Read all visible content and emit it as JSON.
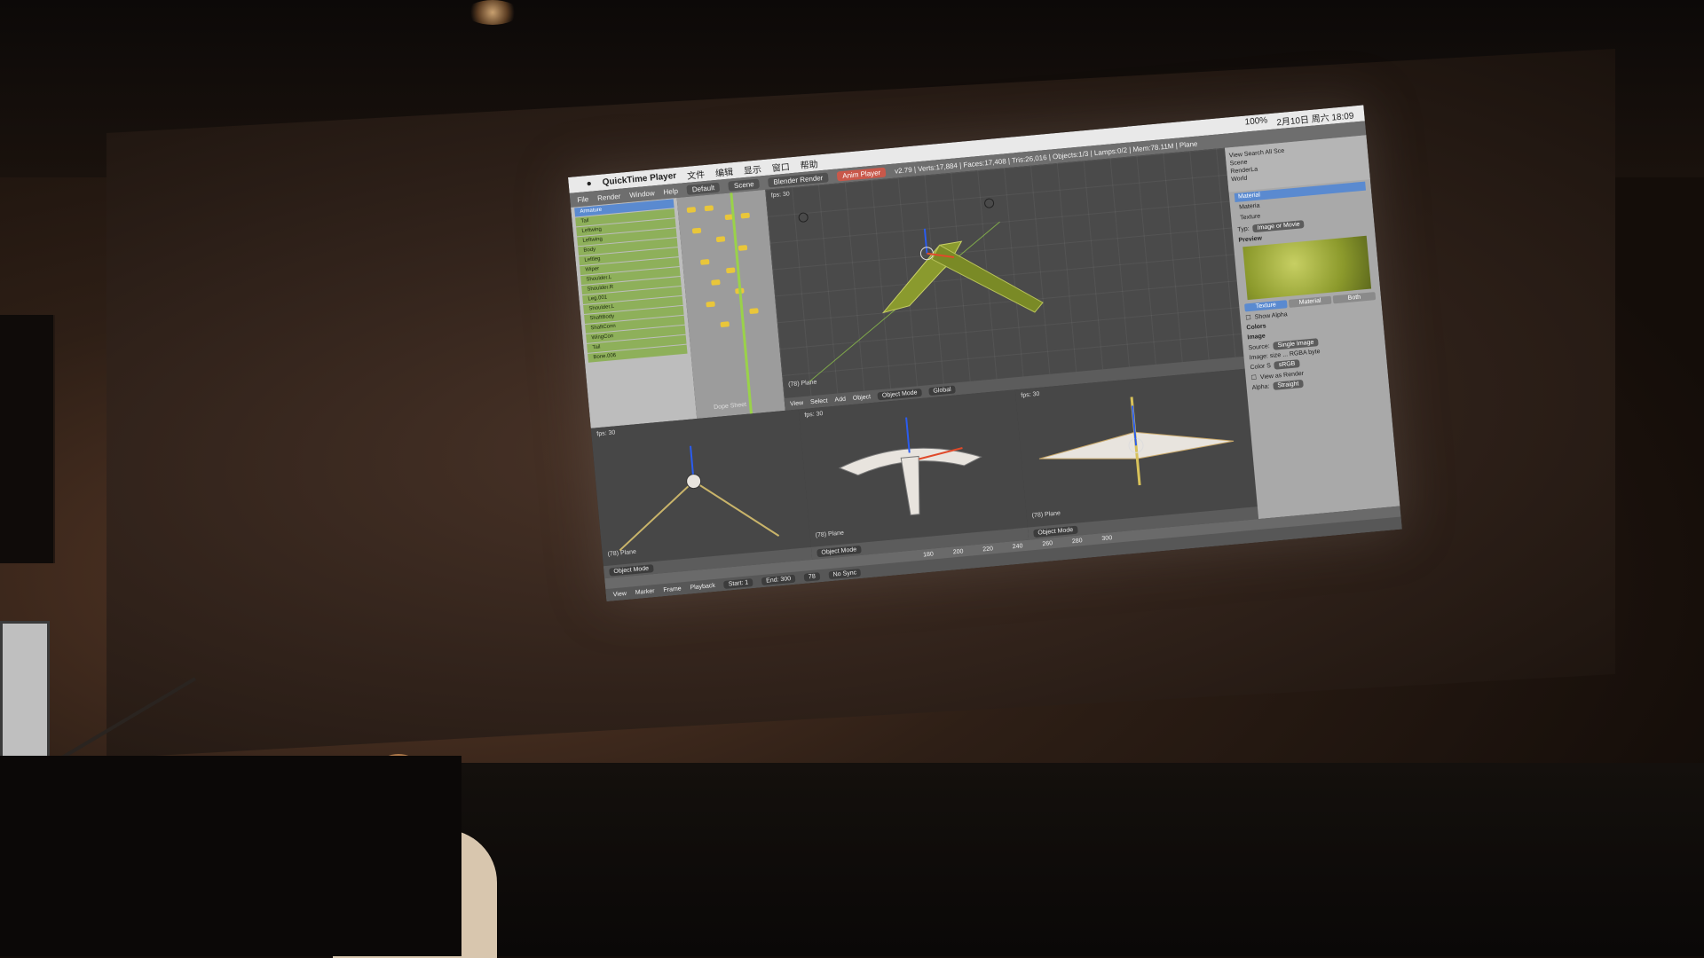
{
  "menubar": {
    "app_name": "QuickTime Player",
    "items": [
      "文件",
      "编辑",
      "显示",
      "窗口",
      "帮助"
    ],
    "status": [
      "100%",
      "2月10日 周六 18:09"
    ]
  },
  "blender_header": {
    "menus": [
      "File",
      "Render",
      "Window",
      "Help"
    ],
    "layout": "Default",
    "scene": "Scene",
    "engine": "Blender Render",
    "anim_player": "Anim Player",
    "stats": "v2.79 | Verts:17,884 | Faces:17,408 | Tris:26,016 | Objects:1/3 | Lamps:0/2 | Mem:78.11M | Plane"
  },
  "channel_list": {
    "rows": [
      "Armature",
      "Tail",
      "Leftwing",
      "Leftwing",
      "Body",
      "Leftleg",
      "Wiper",
      "Shoulder.L",
      "Shoulder.R",
      "Leg.001",
      "Shoulder.L",
      "ShaftBody",
      "ShaftConn",
      "WingCon",
      "Tail",
      "Bone.006"
    ]
  },
  "dopesheet": {
    "label": "Dope Sheet"
  },
  "viewport_main": {
    "fps": "fps: 30",
    "object": "(78) Plane",
    "toolbar": [
      "View",
      "Select",
      "Add",
      "Object"
    ],
    "mode": "Object Mode",
    "orientation": "Global"
  },
  "viewports_low": [
    {
      "fps": "fps: 30",
      "object": "(78) Plane",
      "mode": "Object Mode"
    },
    {
      "fps": "fps: 30",
      "object": "(78) Plane",
      "mode": "Object Mode"
    },
    {
      "fps": "fps: 30",
      "object": "(78) Plane",
      "mode": "Object Mode"
    }
  ],
  "props": {
    "outliner": [
      "View",
      "Search",
      "All Sce",
      "Scene",
      "RenderLa",
      "World"
    ],
    "materials": [
      "Material",
      "Materia",
      "Texture"
    ],
    "texture_type_label": "Typ:",
    "texture_type": "Image or Movie",
    "preview_label": "Preview",
    "preview_tabs": [
      "Texture",
      "Material",
      "Both"
    ],
    "show_alpha": "Show Alpha",
    "colors": "Colors",
    "image": "Image",
    "source_label": "Source:",
    "source": "Single Image",
    "image_size": "Image: size ... RGBA byte",
    "color_space_label": "Color S",
    "color_space": "sRGB",
    "view_as_render": "View as Render",
    "alpha_label": "Alpha:",
    "alpha": "Straight"
  },
  "timeline": {
    "ticks": [
      "180",
      "200",
      "220",
      "240",
      "260",
      "280",
      "300"
    ],
    "menus": [
      "View",
      "Marker",
      "Frame",
      "Playback"
    ],
    "start": "Start: 1",
    "end": "End: 300",
    "current": "78",
    "sync": "No Sync"
  },
  "colors": {
    "menubar": "#e9e9e9",
    "viewport": "#4a4a4a",
    "channel_green": "#8eb05a",
    "selection_blue": "#5a8ad0",
    "keyframe_yellow": "#e9c63a",
    "model_green": "#8a9a2e",
    "model_white": "#e8e4de"
  }
}
